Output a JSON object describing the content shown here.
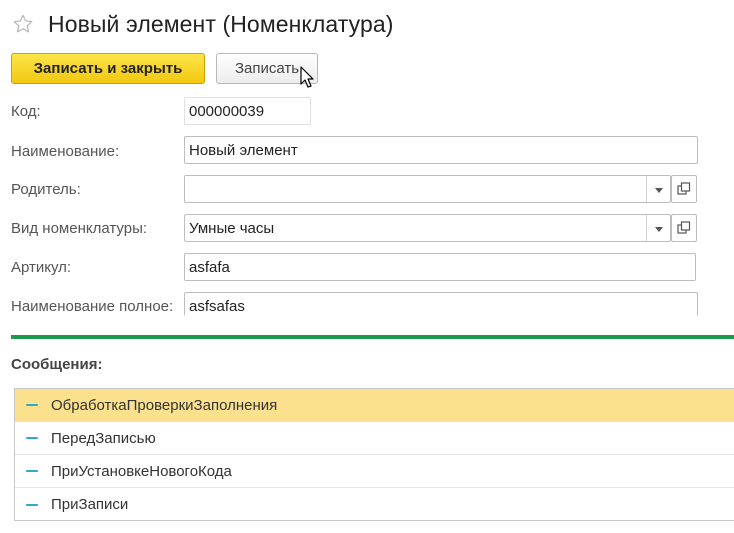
{
  "window": {
    "title": "Новый элемент (Номенклатура)"
  },
  "toolbar": {
    "save_close_label": "Записать и закрыть",
    "save_label": "Записать"
  },
  "form": {
    "code": {
      "label": "Код:",
      "value": "000000039"
    },
    "name": {
      "label": "Наименование:",
      "value": "Новый элемент"
    },
    "parent": {
      "label": "Родитель:",
      "value": ""
    },
    "kind": {
      "label": "Вид номенклатуры:",
      "value": "Умные часы"
    },
    "article": {
      "label": "Артикул:",
      "value": "asfafa"
    },
    "full_name": {
      "label": "Наименование полное:",
      "value": "asfsafas"
    }
  },
  "messages": {
    "title": "Сообщения:",
    "items": [
      "ОбработкаПроверкиЗаполнения",
      "ПередЗаписью",
      "ПриУстановкеНовогоКода",
      "ПриЗаписи"
    ],
    "selected_index": 0
  },
  "colors": {
    "accent_green": "#1a9a4a",
    "primary_button": "#f2c811",
    "selected_row": "#fbe08d",
    "dash": "#2fa8c8"
  }
}
